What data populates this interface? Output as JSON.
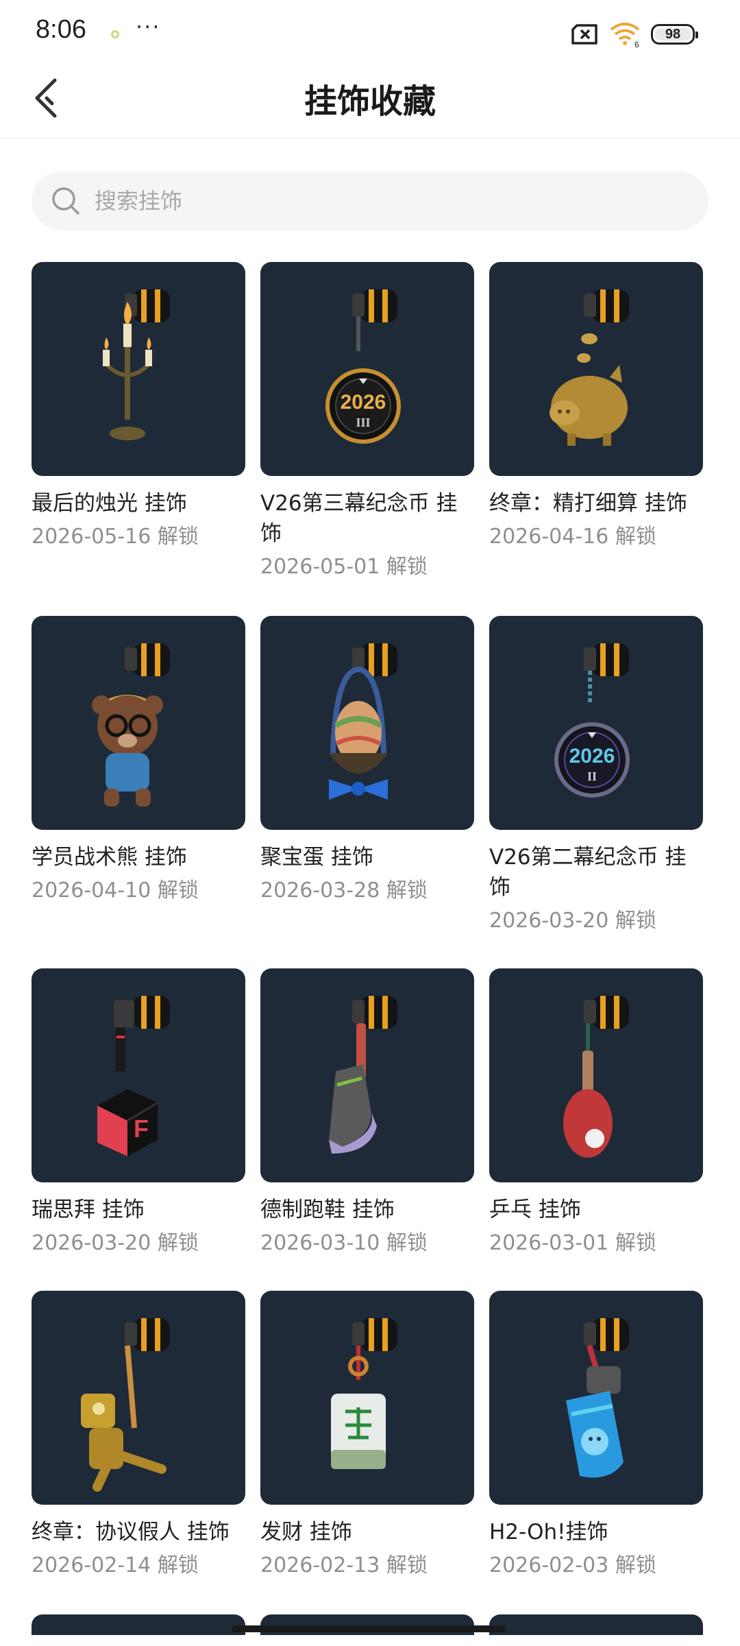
{
  "status_bar": {
    "time": "8:06",
    "more": "···",
    "battery": "98"
  },
  "header": {
    "title": "挂饰收藏"
  },
  "search": {
    "placeholder": "搜索挂饰"
  },
  "items": [
    {
      "title": "最后的烛光 挂饰",
      "date": "2026-05-16 解锁",
      "art": "candelabra"
    },
    {
      "title": "V26第三幕纪念币 挂饰",
      "date": "2026-05-01 解锁",
      "art": "coin-iii"
    },
    {
      "title": "终章：精打细算 挂饰",
      "date": "2026-04-16 解锁",
      "art": "golden-pig"
    },
    {
      "title": "学员战术熊 挂饰",
      "date": "2026-04-10 解锁",
      "art": "bear"
    },
    {
      "title": "聚宝蛋 挂饰",
      "date": "2026-03-28 解锁",
      "art": "egg-basket"
    },
    {
      "title": "V26第二幕纪念币 挂饰",
      "date": "2026-03-20 解锁",
      "art": "coin-ii"
    },
    {
      "title": "瑞思拜 挂饰",
      "date": "2026-03-20 解锁",
      "art": "cube"
    },
    {
      "title": "德制跑鞋 挂饰",
      "date": "2026-03-10 解锁",
      "art": "sneaker"
    },
    {
      "title": "乒乓 挂饰",
      "date": "2026-03-01 解锁",
      "art": "ping-pong"
    },
    {
      "title": "终章：协议假人 挂饰",
      "date": "2026-02-14 解锁",
      "art": "golden-robot"
    },
    {
      "title": "发财 挂饰",
      "date": "2026-02-13 解锁",
      "art": "mahjong-tile"
    },
    {
      "title": "H2-Oh!挂饰",
      "date": "2026-02-03 解锁",
      "art": "water-bottle"
    }
  ]
}
